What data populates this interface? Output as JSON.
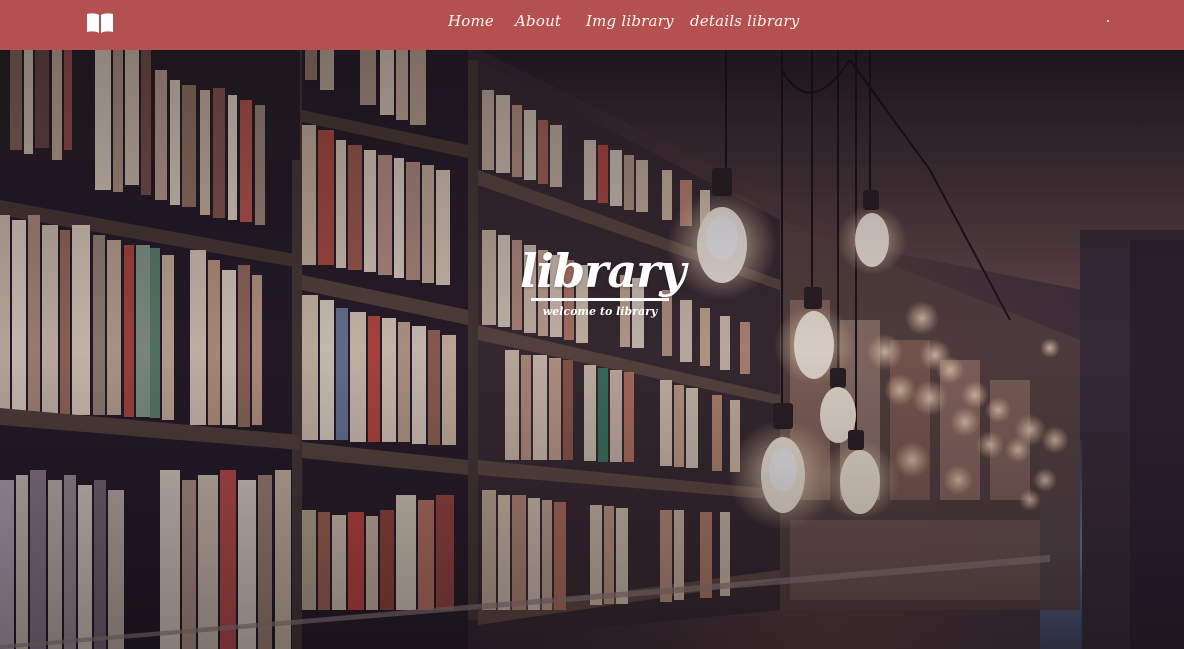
{
  "navbar": {
    "brand_icon": "open-book-icon",
    "links": [
      {
        "label": "Home"
      },
      {
        "label": "About"
      },
      {
        "label": "Img library"
      },
      {
        "label": "details library"
      }
    ],
    "background_color": "#b55050"
  },
  "hero": {
    "title": "library",
    "subtitle": "welcome to library",
    "image_description_icon": "library-bookshelves-photo"
  }
}
